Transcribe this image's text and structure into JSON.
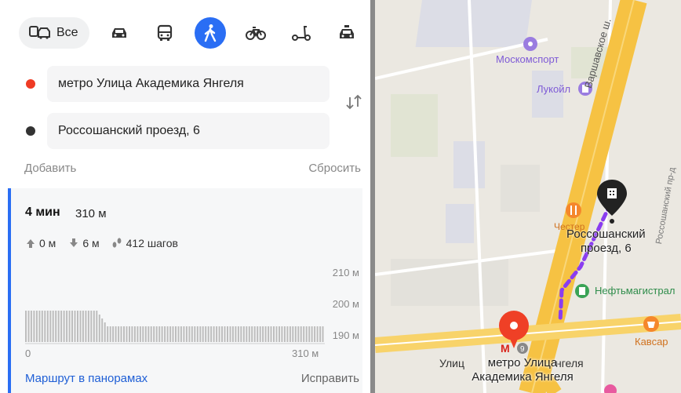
{
  "modes": {
    "all_label": "Все",
    "items": [
      "car-icon",
      "bus-icon",
      "walk-icon",
      "bike-icon",
      "scooter-icon",
      "taxi-icon"
    ],
    "active": "walk-icon"
  },
  "route_form": {
    "from": "метро Улица Академика Янгеля",
    "to": "Россошанский проезд, 6",
    "add_label": "Добавить",
    "reset_label": "Сбросить"
  },
  "route": {
    "time": "4 мин",
    "distance": "310 м",
    "ascent": "0 м",
    "descent": "6 м",
    "steps": "412 шагов",
    "elevation_labels": [
      "210 м",
      "200 м",
      "190 м"
    ],
    "x_start": "0",
    "x_end": "310 м",
    "panorama_link": "Маршрут в панорамах",
    "fix_link": "Исправить"
  },
  "map": {
    "labels": {
      "moskomsport": "Москомспорт",
      "lukoil": "Лукойл",
      "varshavskoe": "Варшавское ш.",
      "chester": "Честер",
      "destination": "Россошанский",
      "destination2": "проезд, 6",
      "rossosh_proezd": "Россошанский пр-д",
      "neftmag": "Нефтьмагистрал",
      "kavsar": "Кавсар",
      "metro_top": "метро Улица",
      "metro_bottom": "Академика Янгеля",
      "street_left": "Улиц",
      "street_right": "нгеля",
      "metro_num": "9"
    },
    "colors": {
      "route": "#8a3df0",
      "road": "#f6c243",
      "start_pin": "#ef4026",
      "dest_pin": "#222222",
      "poi_purple": "#9a7ce0",
      "poi_orange": "#f5872b",
      "poi_green": "#3aa356"
    }
  },
  "colors": {
    "accent": "#2a6ef4",
    "start": "#ef3b24",
    "end": "#333333",
    "link": "#1f5fd6"
  }
}
